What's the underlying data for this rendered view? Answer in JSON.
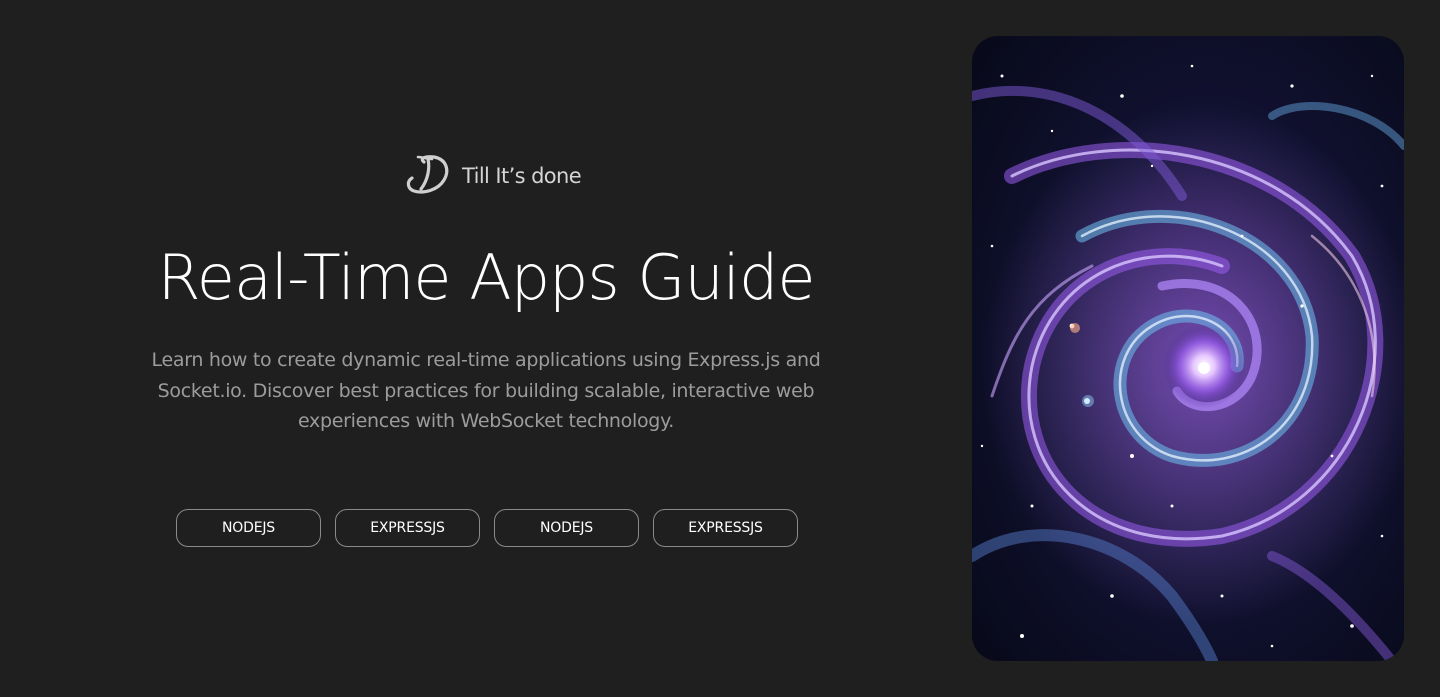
{
  "brand": {
    "name": "Till It’s done",
    "logo_icon": "script-d-logo-icon"
  },
  "hero": {
    "title": "Real-Time Apps Guide",
    "description": "Learn how to create dynamic real-time applications using Express.js and Socket.io. Discover best practices for building scalable, interactive web experiences with WebSocket technology."
  },
  "tags": [
    "NODEJS",
    "EXPRESSJS",
    "NODEJS",
    "EXPRESSJS"
  ],
  "colors": {
    "background": "#1f1f1f",
    "title": "#ffffff",
    "description": "#9c9c9c",
    "tag_border": "#8a8a8a",
    "art_purple": "#9a5cf0",
    "art_blue": "#6ec3f0",
    "art_dark": "#0b0d24"
  }
}
